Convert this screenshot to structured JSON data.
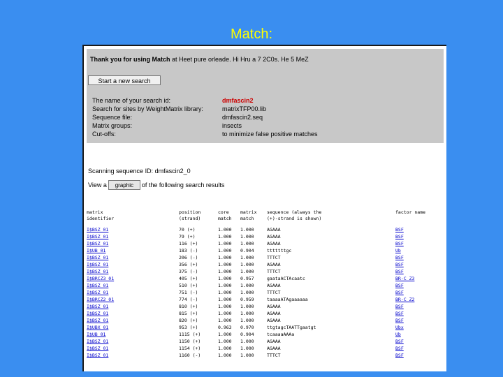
{
  "slide": {
    "title": "Match:"
  },
  "header": {
    "thank_you_bold": "Thank you for using Match",
    "thank_you_rest": " at Heet pure orleade. Hi Hru a 7 2C0s. He 5 MeZ",
    "start_button": "Start a new search"
  },
  "info": [
    {
      "key": "The name of your search id:",
      "value": "dmfascin2",
      "highlight": true
    },
    {
      "key": "Search for sites by WeightMatrix library:",
      "value": "matrixTFP00.lib",
      "highlight": false
    },
    {
      "key": "Sequence file:",
      "value": "dmfascin2.seq",
      "highlight": false
    },
    {
      "key": "Matrix groups:",
      "value": "insects",
      "highlight": false
    },
    {
      "key": "Cut-offs:",
      "value": "to minimize false positive matches",
      "highlight": false
    }
  ],
  "scan": {
    "text": "Scanning sequence ID: dmfascin2_0"
  },
  "view": {
    "prefix": "View a",
    "button": "graphic",
    "suffix": "of the following search results"
  },
  "results": {
    "headers1": [
      "matrix",
      "position",
      "core",
      "matrix",
      "sequence (always the",
      "factor name"
    ],
    "headers2": [
      "identifier",
      "(strand)",
      "match",
      "match",
      "(+)-strand is shown)",
      ""
    ],
    "rows": [
      {
        "id": "I$BSZ_01",
        "pos": "70 (+)",
        "core": "1.000",
        "mat": "1.000",
        "seq": "AGAAA",
        "fac": "BSF"
      },
      {
        "id": "I$BSZ_01",
        "pos": "79 (+)",
        "core": "1.000",
        "mat": "1.000",
        "seq": "AGAAA",
        "fac": "BSF"
      },
      {
        "id": "I$BSZ_01",
        "pos": "116 (+)",
        "core": "1.000",
        "mat": "1.000",
        "seq": "AGAAA",
        "fac": "BSF"
      },
      {
        "id": "I$UB_01",
        "pos": "183 (-)",
        "core": "1.000",
        "mat": "0.904",
        "seq": "tttttttgc",
        "fac": "Ub"
      },
      {
        "id": "I$BSZ_01",
        "pos": "206 (-)",
        "core": "1.000",
        "mat": "1.000",
        "seq": "TTTCT",
        "fac": "BSF"
      },
      {
        "id": "I$BSZ_01",
        "pos": "356 (+)",
        "core": "1.000",
        "mat": "1.000",
        "seq": "AGAAA",
        "fac": "BSF"
      },
      {
        "id": "I$BSZ_01",
        "pos": "375 (-)",
        "core": "1.000",
        "mat": "1.000",
        "seq": "TTTCT",
        "fac": "BSF"
      },
      {
        "id": "I$BRCZ3_01",
        "pos": "405 (+)",
        "core": "1.000",
        "mat": "0.957",
        "seq": "gaataACTAcaatc",
        "fac": "BR-C Z3"
      },
      {
        "id": "I$BSZ_01",
        "pos": "510 (+)",
        "core": "1.000",
        "mat": "1.000",
        "seq": "AGAAA",
        "fac": "BSF"
      },
      {
        "id": "I$BSZ_01",
        "pos": "751 (-)",
        "core": "1.000",
        "mat": "1.000",
        "seq": "TTTCT",
        "fac": "BSF"
      },
      {
        "id": "I$BRCZ2_01",
        "pos": "774 (-)",
        "core": "1.000",
        "mat": "0.959",
        "seq": "taaaaATAgaaaaaa",
        "fac": "BR-C Z2"
      },
      {
        "id": "I$BSZ_01",
        "pos": "810 (+)",
        "core": "1.000",
        "mat": "1.000",
        "seq": "AGAAA",
        "fac": "BSF"
      },
      {
        "id": "I$BSZ_01",
        "pos": "815 (+)",
        "core": "1.000",
        "mat": "1.000",
        "seq": "AGAAA",
        "fac": "BSF"
      },
      {
        "id": "I$BSZ_01",
        "pos": "820 (+)",
        "core": "1.000",
        "mat": "1.000",
        "seq": "AGAAA",
        "fac": "BSF"
      },
      {
        "id": "I$UBX_01",
        "pos": "953 (+)",
        "core": "0.963",
        "mat": "0.970",
        "seq": "ttgtagcTAATTgaatgt",
        "fac": "Ubx"
      },
      {
        "id": "I$UB_01",
        "pos": "1115 (+)",
        "core": "1.000",
        "mat": "0.904",
        "seq": "tcaaaaAAAa",
        "fac": "Ub"
      },
      {
        "id": "I$BSZ_01",
        "pos": "1150 (+)",
        "core": "1.000",
        "mat": "1.000",
        "seq": "AGAAA",
        "fac": "BSF"
      },
      {
        "id": "I$BSZ_01",
        "pos": "1154 (+)",
        "core": "1.000",
        "mat": "1.000",
        "seq": "AGAAA",
        "fac": "BSF"
      },
      {
        "id": "I$BSZ_01",
        "pos": "1160 (-)",
        "core": "1.000",
        "mat": "1.000",
        "seq": "TTTCT",
        "fac": "BSF"
      }
    ]
  }
}
